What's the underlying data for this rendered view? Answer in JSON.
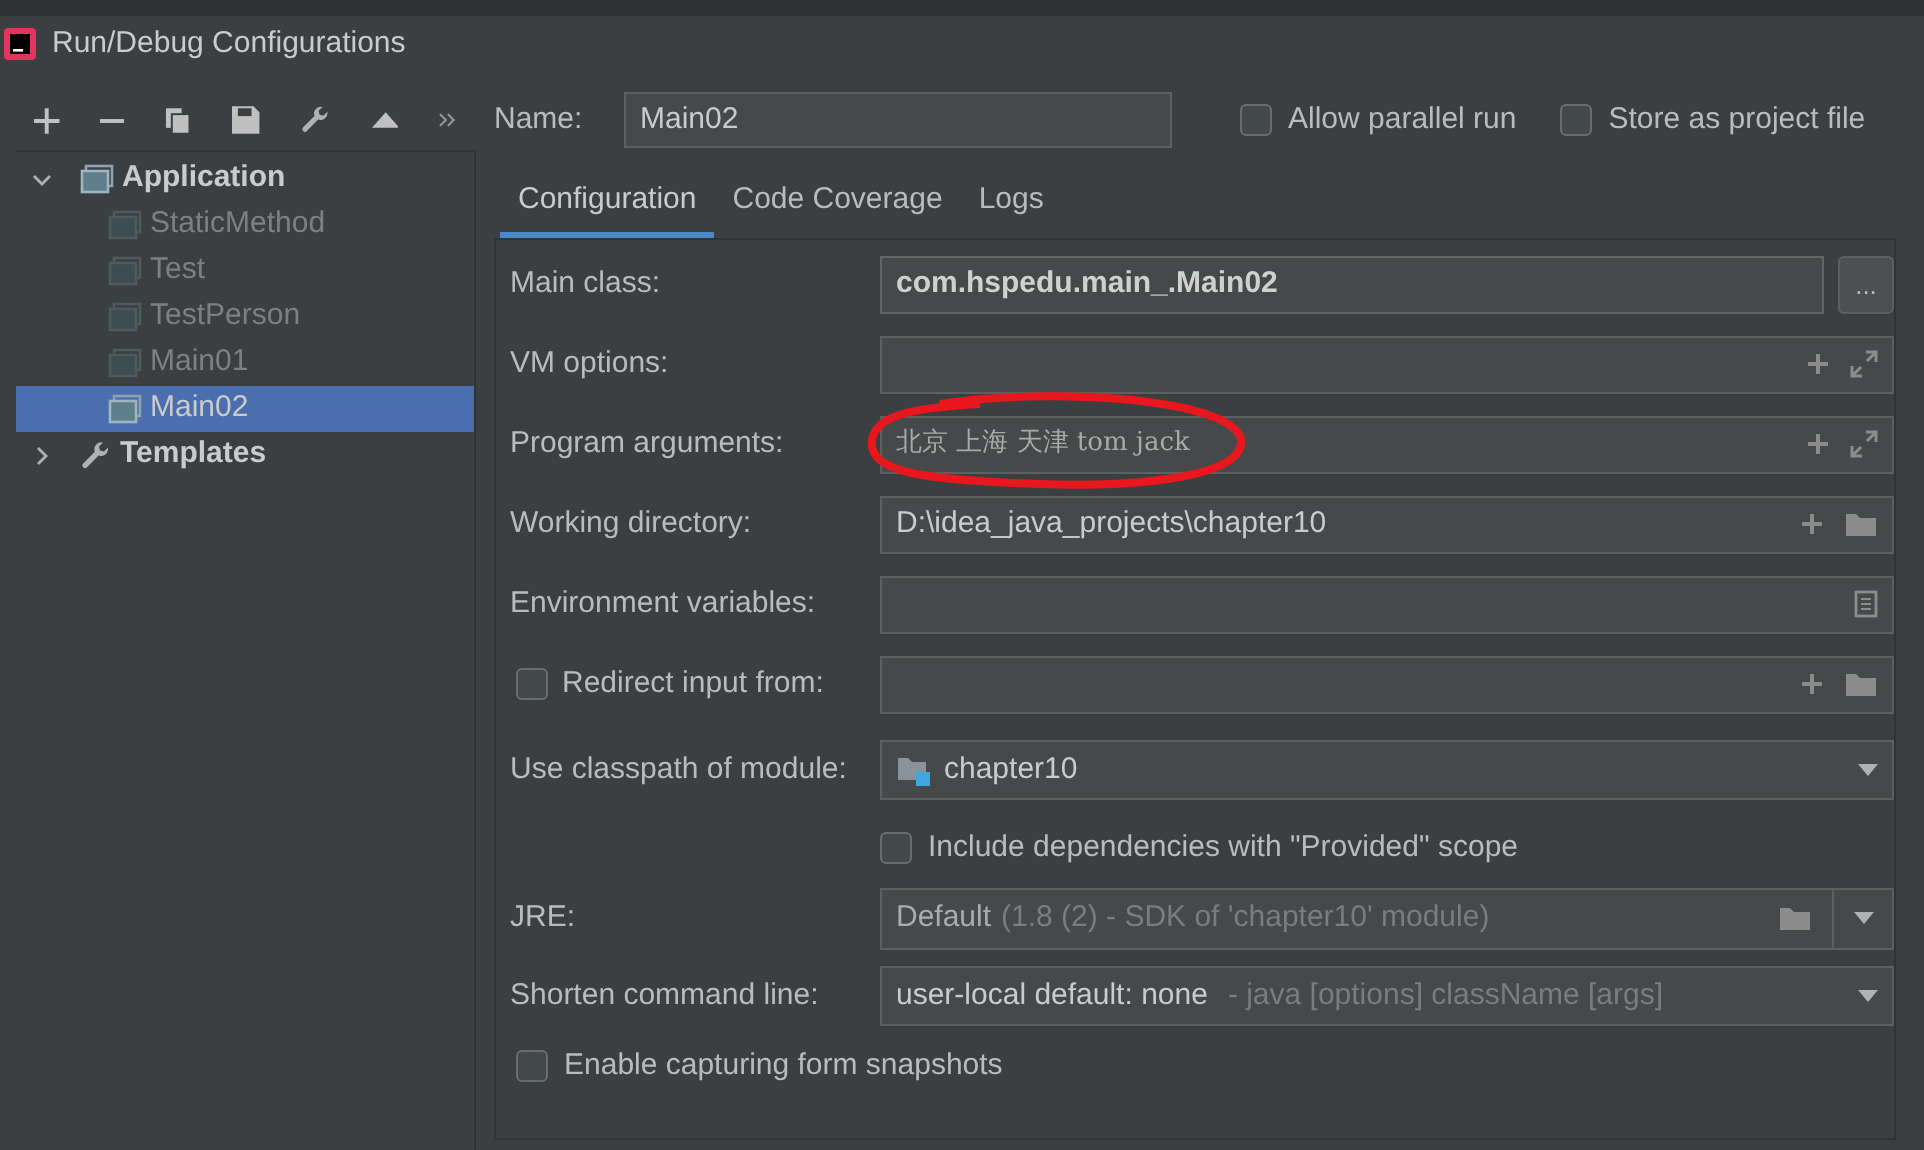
{
  "window": {
    "title": "Run/Debug Configurations"
  },
  "tree": [
    {
      "label": "Application",
      "kind": "group",
      "expanded": true,
      "selected": false,
      "children": [
        {
          "label": "StaticMethod",
          "kind": "config",
          "selected": false
        },
        {
          "label": "Test",
          "kind": "config",
          "selected": false
        },
        {
          "label": "TestPerson",
          "kind": "config",
          "selected": false
        },
        {
          "label": "Main01",
          "kind": "config",
          "selected": false
        },
        {
          "label": "Main02",
          "kind": "config",
          "selected": true
        }
      ]
    },
    {
      "label": "Templates",
      "kind": "templates",
      "expanded": false,
      "selected": false
    }
  ],
  "name": {
    "label": "Name:",
    "value": "Main02"
  },
  "top_options": [
    {
      "label": "Allow parallel run",
      "checked": false
    },
    {
      "label": "Store as project file",
      "checked": false
    }
  ],
  "tabs": [
    {
      "label": "Configuration",
      "selected": true
    },
    {
      "label": "Code Coverage",
      "selected": false
    },
    {
      "label": "Logs",
      "selected": false
    }
  ],
  "form": [
    {
      "kind": "class",
      "label": "Main class:",
      "value": "com.hspedu.main_.Main02",
      "button": "..."
    },
    {
      "kind": "expand",
      "label": "VM options:"
    },
    {
      "kind": "expand",
      "label": "Program arguments:",
      "value": "北京 上海 天津 tom jack",
      "annotated": true
    },
    {
      "kind": "folder",
      "label": "Working directory:",
      "value": "D:\\idea_java_projects\\chapter10"
    },
    {
      "kind": "env",
      "label": "Environment variables:"
    },
    {
      "kind": "redirect",
      "label": "Redirect input from:",
      "checked": false
    },
    {
      "kind": "module",
      "label": "Use classpath of module:",
      "value": "chapter10"
    },
    {
      "kind": "subcheck",
      "label": "Include dependencies with \"Provided\" scope",
      "checked": false
    },
    {
      "kind": "jre",
      "label": "JRE:",
      "value": "Default",
      "detail": "(1.8 (2) - SDK of 'chapter10' module)"
    },
    {
      "kind": "combo",
      "label": "Shorten command line:",
      "value": "user-local default: none",
      "detail": "- java [options] className [args]"
    },
    {
      "kind": "check",
      "label": "Enable capturing form snapshots",
      "checked": false
    }
  ]
}
